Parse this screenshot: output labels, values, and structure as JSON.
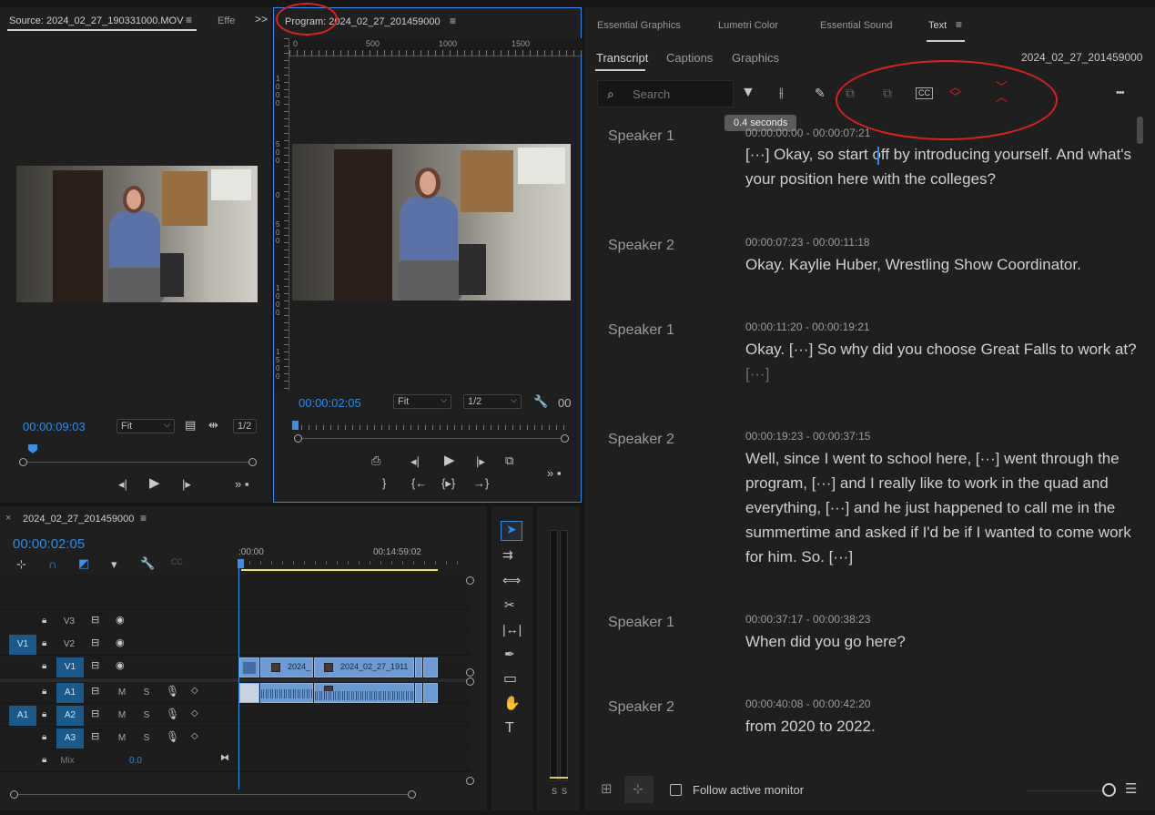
{
  "source_monitor": {
    "tab_label": "Source: 2024_02_27_190331000.MOV",
    "effects_tab": "Effe",
    "overflow": ">>",
    "timecode": "00:00:09:03",
    "fit": "Fit",
    "resolution": "1/2"
  },
  "program_monitor": {
    "tab_label": "Program: 2024_02_27_201459000",
    "ruler_labels": [
      "0",
      "500",
      "1000",
      "1500"
    ],
    "vruler_labels": [
      "1 0 0 0",
      "5 0 0",
      "0",
      "5 0 0",
      "1 0 0 0",
      "1 5 0 0"
    ],
    "timecode": "00:00:02:05",
    "fit": "Fit",
    "resolution": "1/2",
    "trailing": "00"
  },
  "timeline": {
    "close": "×",
    "sequence_name": "2024_02_27_201459000",
    "timecode": "00:00:02:05",
    "ruler_start": ":00:00",
    "ruler_mark": "00:14:59:02",
    "tracks": [
      {
        "name": "V3",
        "target": ""
      },
      {
        "name": "V2",
        "target": "V1"
      },
      {
        "name": "V1",
        "target": ""
      },
      {
        "name": "A1",
        "target": ""
      },
      {
        "name": "A2",
        "target": "A1"
      },
      {
        "name": "A3",
        "target": ""
      }
    ],
    "mute": "M",
    "solo": "S",
    "mix_label": "Mix",
    "mix_value": "0.0",
    "clip_short": "2024_",
    "clip_long": "2024_02_27_1911"
  },
  "meters": {
    "solo_left": "S",
    "solo_right": "S"
  },
  "right_panel": {
    "top_tabs": [
      "Essential Graphics",
      "Lumetri Color",
      "Essential Sound",
      "Text"
    ],
    "sub_tabs": [
      "Transcript",
      "Captions",
      "Graphics"
    ],
    "sequence_name": "2024_02_27_201459000",
    "search_placeholder": "Search",
    "tooltip": "0.4 seconds",
    "follow_label": "Follow active monitor",
    "more": "•••"
  },
  "transcript": [
    {
      "speaker": "Speaker 1",
      "timecode": "00:00:00:00 - 00:00:07:21",
      "lines": [
        "[···] Okay, so start off by introducing yourself. And what's",
        "your position here with the colleges?"
      ]
    },
    {
      "speaker": "Speaker 2",
      "timecode": "00:00:07:23 - 00:00:11:18",
      "lines": [
        "Okay. Kaylie Huber, Wrestling Show Coordinator."
      ]
    },
    {
      "speaker": "Speaker 1",
      "timecode": "00:00:11:20 - 00:00:19:21",
      "lines": [
        "Okay. [···] So why did you choose Great Falls to work at?",
        "[···]"
      ]
    },
    {
      "speaker": "Speaker 2",
      "timecode": "00:00:19:23 - 00:00:37:15",
      "lines": [
        "Well, since I went to school here, [···] went through the",
        "program, [···] and I really like to work in the quad and",
        "everything, [···] and he just happened to call me in the",
        "summertime and asked if I'd be if I wanted to come work",
        "for him. So. [···]"
      ]
    },
    {
      "speaker": "Speaker 1",
      "timecode": "00:00:37:17 - 00:00:38:23",
      "lines": [
        "When did you go here?"
      ]
    },
    {
      "speaker": "Speaker 2",
      "timecode": "00:00:40:08 - 00:00:42:20",
      "lines": [
        "from 2020 to 2022."
      ]
    }
  ],
  "colors": {
    "accent": "#2d8ceb",
    "annotation": "#e0201c",
    "clip": "#6b9bd1",
    "playhead": "#3c8fe8"
  }
}
